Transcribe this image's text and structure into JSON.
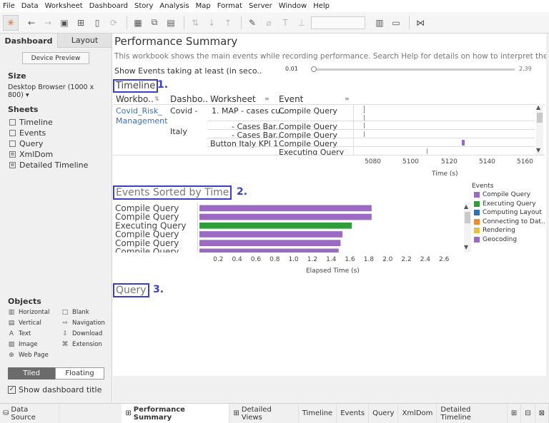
{
  "menu": [
    "File",
    "Data",
    "Worksheet",
    "Dashboard",
    "Story",
    "Analysis",
    "Map",
    "Format",
    "Server",
    "Window",
    "Help"
  ],
  "left_panel": {
    "tab_dashboard": "Dashboard",
    "tab_layout": "Layout",
    "device_preview": "Device Preview",
    "size_heading": "Size",
    "size_value": "Desktop Browser (1000 x 800)",
    "sheets_heading": "Sheets",
    "sheets": [
      "Timeline",
      "Events",
      "Query",
      "XmlDom",
      "Detailed Timeline"
    ],
    "objects_heading": "Objects",
    "objects": {
      "horizontal": "Horizontal",
      "blank": "Blank",
      "vertical": "Vertical",
      "navigation": "Navigation",
      "text": "Text",
      "download": "Download",
      "image": "Image",
      "extension": "Extension",
      "web_page": "Web Page"
    },
    "tiled": "Tiled",
    "floating": "Floating",
    "show_title": "Show dashboard title"
  },
  "dashboard": {
    "title": "Performance Summary",
    "description": "This workbook shows the main events while recording performance. Search Help for details on how to interpret the workbook and...",
    "filter_label": "Show Events taking at least (in seco..",
    "filter_min": "0.01",
    "filter_max": "2.39",
    "filter_value": 0.0,
    "timeline_label": "Timeline",
    "timeline_num": "1.",
    "timeline_headers": [
      "Workbo..",
      "Dashbo..",
      "Worksheet",
      "Event"
    ],
    "timeline_workbook": [
      "Covid_Risk_",
      "Management"
    ],
    "timeline_dashboard": [
      "Covid -",
      "Italy"
    ],
    "timeline_worksheets": [
      "1. MAP - cases cu..",
      "- Cases Bar..",
      "- Cases Bar..",
      "Button Italy  KPI 1"
    ],
    "timeline_events": [
      "Compile Query",
      "Compile Query",
      "Compile Query",
      "Compile Query",
      "Executing Query"
    ],
    "timeline_axis_ticks": [
      "5080",
      "5100",
      "5120",
      "5140",
      "5160"
    ],
    "timeline_axis_title": "Time (s)",
    "events_label": "Events Sorted by Time",
    "events_num": "2.",
    "events_rows": [
      "Compile Query",
      "Compile Query",
      "Executing Query",
      "Compile Query",
      "Compile Query",
      "Compile Query"
    ],
    "events_axis_title": "Elapsed Time (s)",
    "query_label": "Query",
    "query_num": "3.",
    "legend_title": "Events",
    "legend": [
      {
        "label": "Compile Query",
        "color": "#9b6bc4"
      },
      {
        "label": "Executing Query",
        "color": "#2e9e3a"
      },
      {
        "label": "Computing Layout",
        "color": "#2d6fb5"
      },
      {
        "label": "Connecting to Dat..",
        "color": "#f28c28"
      },
      {
        "label": "Rendering",
        "color": "#e8c23a"
      },
      {
        "label": "Geocoding",
        "color": "#9b6bc4"
      }
    ]
  },
  "chart_data": {
    "type": "bar",
    "orientation": "horizontal",
    "categories": [
      "Compile Query",
      "Compile Query",
      "Executing Query",
      "Compile Query",
      "Compile Query",
      "Compile Query"
    ],
    "values": [
      1.83,
      1.83,
      1.62,
      1.52,
      1.5,
      1.48
    ],
    "colors": [
      "#9b6bc4",
      "#9b6bc4",
      "#2e9e3a",
      "#9b6bc4",
      "#9b6bc4",
      "#9b6bc4"
    ],
    "xlabel": "Elapsed Time (s)",
    "ticks": [
      0.2,
      0.4,
      0.6,
      0.8,
      1.0,
      1.2,
      1.4,
      1.6,
      1.8,
      2.0,
      2.2,
      2.4,
      2.6
    ],
    "xlim": [
      0,
      2.72
    ]
  },
  "tabs": {
    "data_source": "Data Source",
    "sheets": [
      "Performance Summary",
      "Detailed Views",
      "Timeline",
      "Events",
      "Query",
      "XmlDom",
      "Detailed Timeline"
    ]
  }
}
